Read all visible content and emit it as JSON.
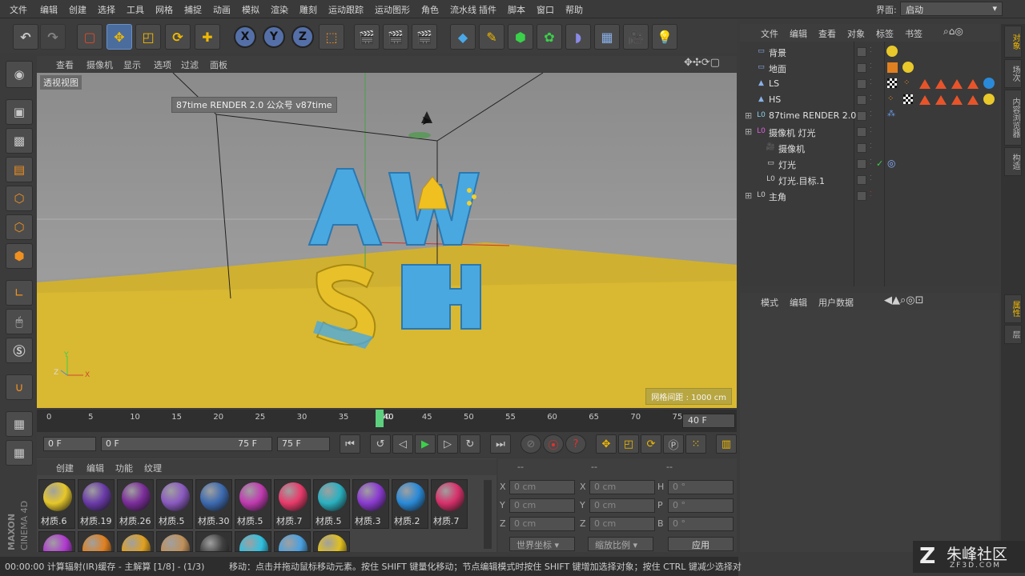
{
  "menubar": {
    "items": [
      "文件",
      "编辑",
      "创建",
      "选择",
      "工具",
      "网格",
      "捕捉",
      "动画",
      "模拟",
      "渲染",
      "雕刻",
      "运动跟踪",
      "运动图形",
      "角色",
      "流水线",
      "插件",
      "脚本",
      "窗口",
      "帮助"
    ],
    "interface_label": "界面:",
    "interface_value": "启动"
  },
  "viewport_menu": {
    "items": [
      "查看",
      "摄像机",
      "显示",
      "选项",
      "过滤",
      "面板"
    ]
  },
  "viewport": {
    "view_name": "透视视图",
    "render_label": "87time RENDER 2.0  公众号 v87time",
    "grid_spacing": "网格间距 : 1000 cm",
    "axis_x": "X",
    "axis_y": "Y",
    "axis_z": "Z"
  },
  "timeline": {
    "ticks": [
      "0",
      "5",
      "10",
      "15",
      "20",
      "25",
      "30",
      "35",
      "40",
      "45",
      "50",
      "55",
      "60",
      "65",
      "70",
      "75"
    ],
    "current": "40",
    "frame_field": "40 F"
  },
  "playback": {
    "start": "0 F",
    "range_start": "0 F",
    "range_end": "75 F",
    "end": "75 F"
  },
  "material_menu": {
    "items": [
      "创建",
      "编辑",
      "功能",
      "纹理"
    ]
  },
  "materials": [
    {
      "name": "材质.6",
      "color": "#e6c72a"
    },
    {
      "name": "材质.19",
      "color": "#6a3aa8"
    },
    {
      "name": "材质.26",
      "color": "#7b2c9a"
    },
    {
      "name": "材质.5",
      "color": "#8a5ac0"
    },
    {
      "name": "材质.30",
      "color": "#3c6ab0"
    },
    {
      "name": "材质.5",
      "color": "#c03ab0"
    },
    {
      "name": "材质.7",
      "color": "#e83a6a"
    },
    {
      "name": "材质.5",
      "color": "#2ab0c0"
    },
    {
      "name": "材质.3",
      "color": "#8a3ad0"
    },
    {
      "name": "材质.2",
      "color": "#2a8ad8"
    },
    {
      "name": "材质.7",
      "color": "#d8306a"
    }
  ],
  "materials_row2": [
    {
      "color": "#b03ad0"
    },
    {
      "color": "#e08020"
    },
    {
      "color": "#e0a020"
    },
    {
      "color": "#c0905a"
    },
    {
      "color": "#404040"
    },
    {
      "color": "#30c0e0"
    },
    {
      "color": "#4aa0e0"
    },
    {
      "color": "#e0c020"
    }
  ],
  "coords": {
    "header": [
      "--",
      "--",
      "--"
    ],
    "rows": [
      {
        "a": "X",
        "av": "0 cm",
        "b": "X",
        "bv": "0 cm",
        "c": "H",
        "cv": "0 °"
      },
      {
        "a": "Y",
        "av": "0 cm",
        "b": "Y",
        "bv": "0 cm",
        "c": "P",
        "cv": "0 °"
      },
      {
        "a": "Z",
        "av": "0 cm",
        "b": "Z",
        "bv": "0 cm",
        "c": "B",
        "cv": "0 °"
      }
    ],
    "world": "世界坐标",
    "scale": "缩放比例",
    "apply": "应用"
  },
  "status": {
    "time": "00:00:00 计算辐射(IR)缓存 - 主解算 [1/8] - (1/3)",
    "msg": "移动：点击并拖动鼠标移动元素。按住 SHIFT 键量化移动；节点编辑模式时按住 SHIFT 键增加选择对象；按住 CTRL 键减少选择对"
  },
  "object_menu": {
    "items": [
      "文件",
      "编辑",
      "查看",
      "对象",
      "标签",
      "书签"
    ]
  },
  "objects": [
    {
      "name": "背景",
      "indent": 0
    },
    {
      "name": "地面",
      "indent": 0
    },
    {
      "name": "LS",
      "indent": 0
    },
    {
      "name": "HS",
      "indent": 0
    },
    {
      "name": "87time RENDER 2.0",
      "indent": 0
    },
    {
      "name": "摄像机 灯光",
      "indent": 0
    },
    {
      "name": "摄像机",
      "indent": 1
    },
    {
      "name": "灯光",
      "indent": 1
    },
    {
      "name": "灯光.目标.1",
      "indent": 1
    },
    {
      "name": "主角",
      "indent": 0
    }
  ],
  "attr_menu": {
    "items": [
      "模式",
      "编辑",
      "用户数据"
    ]
  },
  "right_tabs": [
    "对象",
    "场次",
    "内容浏览器",
    "构造",
    "属性",
    "层"
  ],
  "logo": {
    "text": "朱峰社区",
    "sub": "ZF3D.COM",
    "product": "MAXON CINEMA 4D"
  }
}
